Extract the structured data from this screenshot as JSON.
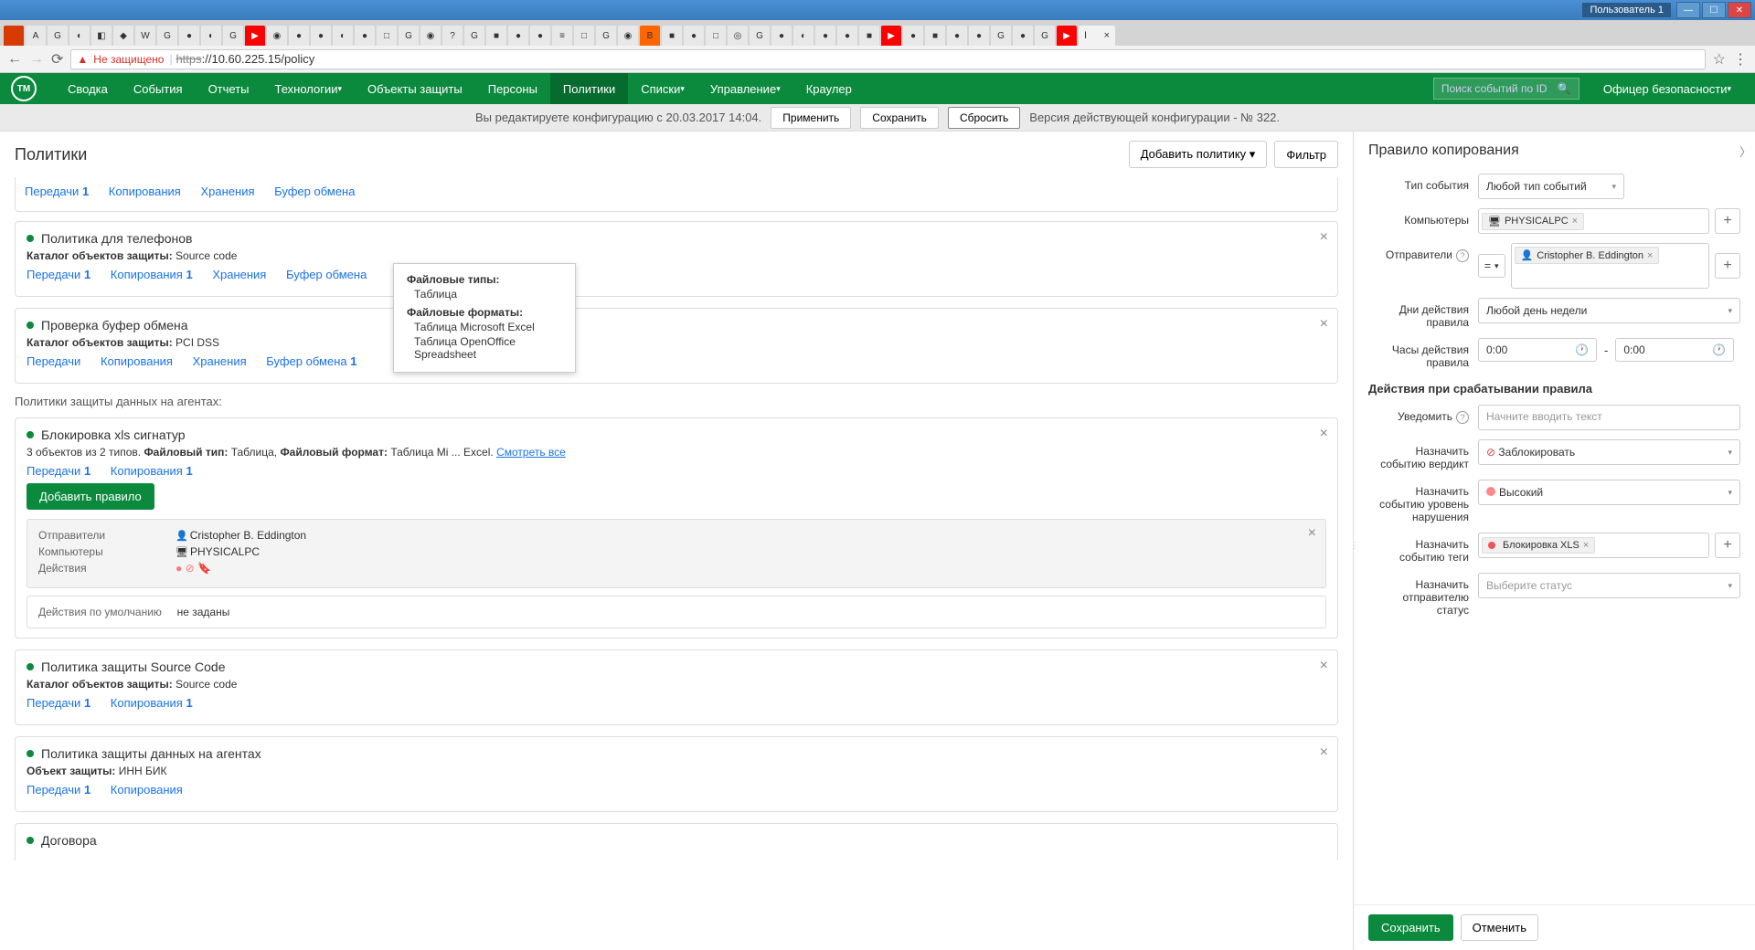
{
  "window": {
    "user": "Пользователь 1"
  },
  "browser": {
    "not_secure": "Не защищено",
    "url_proto": "https",
    "url_rest": "://10.60.225.15/policy",
    "tab_close": "×"
  },
  "nav": {
    "logo": "ТМ",
    "items": [
      "Сводка",
      "События",
      "Отчеты",
      "Технологии",
      "Объекты защиты",
      "Персоны",
      "Политики",
      "Списки",
      "Управление",
      "Краулер"
    ],
    "search_placeholder": "Поиск событий по ID",
    "user": "Офицер безопасности"
  },
  "config_bar": {
    "msg": "Вы редактируете конфигурацию с 20.03.2017 14:04.",
    "apply": "Применить",
    "save": "Сохранить",
    "reset": "Сбросить",
    "version": "Версия действующей конфигурации - № 322."
  },
  "left": {
    "title": "Политики",
    "add_policy": "Добавить политику",
    "filter": "Фильтр",
    "top_links": {
      "transfer": "Передачи",
      "copy": "Копирования",
      "store": "Хранения",
      "clip": "Буфер обмена",
      "one": "1"
    },
    "card_phone": {
      "title": "Политика для телефонов",
      "catalog_label": "Каталог объектов защиты:",
      "catalog_val": "Source code",
      "transfer": "Передачи",
      "copy": "Копирования",
      "store": "Хранения",
      "clip": "Буфер обмена",
      "one": "1"
    },
    "card_clip": {
      "title": "Проверка буфер обмена",
      "catalog_label": "Каталог объектов защиты:",
      "catalog_val": "PCI DSS",
      "transfer": "Передачи",
      "copy": "Копирования",
      "store": "Хранения",
      "clip": "Буфер обмена",
      "one": "1"
    },
    "agent_section": "Политики защиты данных на агентах:",
    "card_xls": {
      "title": "Блокировка xls сигнатур",
      "summary_pre": "3 объектов из 2 типов.",
      "ft_label": "Файловый тип:",
      "ft_val": "Таблица,",
      "ff_label": "Файловый формат:",
      "ff_val": "Таблица Mi ... Excel.",
      "see_all": "Смотреть все",
      "transfer": "Передачи",
      "copy": "Копирования",
      "one": "1",
      "add_rule": "Добавить правило",
      "rule": {
        "senders_label": "Отправители",
        "sender": "Cristopher B. Eddington",
        "computers_label": "Компьютеры",
        "computer": "PHYSICALPC",
        "actions_label": "Действия"
      },
      "default_label": "Действия по умолчанию",
      "default_val": "не заданы"
    },
    "card_source": {
      "title": "Политика защиты Source Code",
      "catalog_label": "Каталог объектов защиты:",
      "catalog_val": "Source code",
      "transfer": "Передачи",
      "copy": "Копирования",
      "one": "1"
    },
    "card_agent": {
      "title": "Политика защиты данных на агентах",
      "obj_label": "Объект защиты:",
      "obj_val": "ИНН БИК",
      "transfer": "Передачи",
      "copy": "Копирования",
      "one": "1"
    },
    "card_dogovor": {
      "title": "Договора"
    }
  },
  "tooltip": {
    "ft_label": "Файловые типы:",
    "ft1": "Таблица",
    "ff_label": "Файловые форматы:",
    "ff1": "Таблица Microsoft Excel",
    "ff2": "Таблица OpenOffice Spreadsheet"
  },
  "right": {
    "title": "Правило копирования",
    "event_type_label": "Тип события",
    "event_type_val": "Любой тип событий",
    "computers_label": "Компьютеры",
    "computer_chip": "PHYSICALPC",
    "senders_label": "Отправители",
    "eq": "=",
    "sender_chip": "Cristopher B. Eddington",
    "days_label": "Дни действия правила",
    "days_val": "Любой день недели",
    "hours_label": "Часы действия правила",
    "time_from": "0:00",
    "time_to": "0:00",
    "actions_title": "Действия при срабатывании правила",
    "notify_label": "Уведомить",
    "notify_placeholder": "Начните вводить текст",
    "verdict_label": "Назначить событию вердикт",
    "verdict_val": "Заблокировать",
    "level_label": "Назначить событию уровень нарушения",
    "level_val": "Высокий",
    "tags_label": "Назначить событию теги",
    "tag_chip": "Блокировка XLS",
    "status_label": "Назначить отправителю статус",
    "status_val": "Выберите статус",
    "save": "Сохранить",
    "cancel": "Отменить"
  }
}
